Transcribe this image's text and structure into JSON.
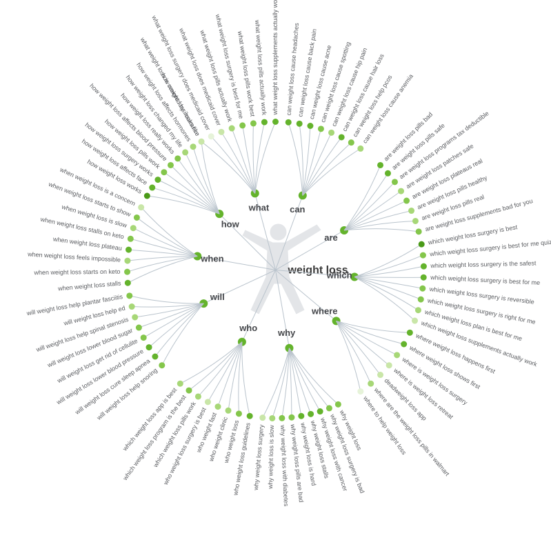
{
  "center": "weight loss",
  "colors": {
    "shade0": "#e6f3d9",
    "shade1": "#c9e6a8",
    "shade2": "#a7d777",
    "shade3": "#84c64b",
    "shade4": "#64b32c",
    "shade5": "#4a9a18"
  },
  "categories": [
    {
      "key": "what",
      "label": "what",
      "angle": -105,
      "leaves": [
        {
          "text": "what weight loss is covered by insurance",
          "shade": 0
        },
        {
          "text": "what weight loss surgery does medicaid cover",
          "shade": 0
        },
        {
          "text": "what weight loss does medicaid cover",
          "shade": 1
        },
        {
          "text": "what weight loss pills actually work",
          "shade": 2
        },
        {
          "text": "what weight loss surgery is best for me",
          "shade": 3
        },
        {
          "text": "what weight loss pills work best",
          "shade": 3
        },
        {
          "text": "what weight loss pills actually work",
          "shade": 4
        },
        {
          "text": "what weight loss supplements actually work",
          "shade": 4
        }
      ]
    },
    {
      "key": "can",
      "label": "can",
      "angle": -70,
      "leaves": [
        {
          "text": "can weight loss cause headaches",
          "shade": 4
        },
        {
          "text": "can weight loss cause back pain",
          "shade": 4
        },
        {
          "text": "can weight loss cause acne",
          "shade": 4
        },
        {
          "text": "can weight loss cause spotting",
          "shade": 3
        },
        {
          "text": "can weight loss cause hip pain",
          "shade": 2
        },
        {
          "text": "can weight loss cause hair loss",
          "shade": 4
        },
        {
          "text": "can weight loss help pcos",
          "shade": 3
        },
        {
          "text": "can weight loss cause anemia",
          "shade": 2
        }
      ]
    },
    {
      "key": "are",
      "label": "are",
      "angle": -30,
      "leaves": [
        {
          "text": "are weight loss pills bad",
          "shade": 4
        },
        {
          "text": "are weight loss pills safe",
          "shade": 4
        },
        {
          "text": "are weight loss programs tax deductible",
          "shade": 3
        },
        {
          "text": "are weight loss patches safe",
          "shade": 2
        },
        {
          "text": "are weight loss plateaus real",
          "shade": 3
        },
        {
          "text": "are weight loss pills healthy",
          "shade": 2
        },
        {
          "text": "are weight loss pills real",
          "shade": 2
        },
        {
          "text": "are weight loss supplements bad for you",
          "shade": 3
        }
      ]
    },
    {
      "key": "which",
      "label": "which",
      "angle": 5,
      "leaves": [
        {
          "text": "which weight loss surgery is best",
          "shade": 5
        },
        {
          "text": "which weight loss surgery is best for me quiz",
          "shade": 3
        },
        {
          "text": "which weight loss surgery is the safest",
          "shade": 4
        },
        {
          "text": "which weight loss surgery is best for me",
          "shade": 4
        },
        {
          "text": "which weight loss surgery is reversible",
          "shade": 3
        },
        {
          "text": "which weight loss surgery is right for me",
          "shade": 3
        },
        {
          "text": "which weight loss plan is best for me",
          "shade": 2
        },
        {
          "text": "which weight loss supplements actually work",
          "shade": 1
        }
      ]
    },
    {
      "key": "where",
      "label": "where",
      "angle": 40,
      "leaves": [
        {
          "text": "where weight loss happens first",
          "shade": 4
        },
        {
          "text": "where weight loss shows first",
          "shade": 4
        },
        {
          "text": "where is weight loss surgery",
          "shade": 2
        },
        {
          "text": "where is weight loss retreat",
          "shade": 1
        },
        {
          "text": "deadweight loss app",
          "shade": 1
        },
        {
          "text": "where are the weight loss pills in walmart",
          "shade": 2
        },
        {
          "text": "where to help weight loss",
          "shade": 0
        }
      ]
    },
    {
      "key": "why",
      "label": "why",
      "angle": 80,
      "leaves": [
        {
          "text": "why weight loss",
          "shade": 3
        },
        {
          "text": "why weight loss surgery is bad",
          "shade": 3
        },
        {
          "text": "why weight loss with cancer",
          "shade": 4
        },
        {
          "text": "why weight loss stalls",
          "shade": 4
        },
        {
          "text": "why weight loss is hard",
          "shade": 4
        },
        {
          "text": "why weight loss pills are bad",
          "shade": 3
        },
        {
          "text": "why weight loss with diabetes",
          "shade": 3
        },
        {
          "text": "why weight loss is slow",
          "shade": 2
        },
        {
          "text": "why weight loss surgery",
          "shade": 1
        }
      ]
    },
    {
      "key": "who",
      "label": "who",
      "angle": 115,
      "leaves": [
        {
          "text": "who weight loss guidelines",
          "shade": 4
        },
        {
          "text": "who weight loss",
          "shade": 3
        },
        {
          "text": "who weight clinic",
          "shade": 2
        },
        {
          "text": "who weight fast",
          "shade": 2
        },
        {
          "text": "who weight loss surgery is best",
          "shade": 1
        },
        {
          "text": "which weight loss pills work",
          "shade": 2
        },
        {
          "text": "which weight loss program is the best",
          "shade": 3
        },
        {
          "text": "which weight loss app is best",
          "shade": 2
        }
      ]
    },
    {
      "key": "will",
      "label": "will",
      "angle": 155,
      "leaves": [
        {
          "text": "will weight loss help snoring",
          "shade": 3
        },
        {
          "text": "will weight loss cure sleep apnea",
          "shade": 4
        },
        {
          "text": "will weight loss lower blood pressure",
          "shade": 4
        },
        {
          "text": "will weight loss get rid of cellulite",
          "shade": 3
        },
        {
          "text": "will weight loss lower blood sugar",
          "shade": 3
        },
        {
          "text": "will weight loss help spinal stenosis",
          "shade": 2
        },
        {
          "text": "will weight loss help ed",
          "shade": 2
        },
        {
          "text": "will weight loss help plantar fasciitis",
          "shade": 3
        }
      ]
    },
    {
      "key": "when",
      "label": "when",
      "angle": 190,
      "leaves": [
        {
          "text": "when weight loss stalls",
          "shade": 4
        },
        {
          "text": "when weight loss starts on keto",
          "shade": 3
        },
        {
          "text": "when weight loss feels impossible",
          "shade": 2
        },
        {
          "text": "when weight loss plateau",
          "shade": 4
        },
        {
          "text": "when weight loss stalls on keto",
          "shade": 3
        },
        {
          "text": "when weight loss is slow",
          "shade": 2
        },
        {
          "text": "when weight loss starts to show",
          "shade": 3
        },
        {
          "text": "when weight loss is a concern",
          "shade": 1
        }
      ]
    },
    {
      "key": "how",
      "label": "how",
      "angle": 225,
      "leaves": [
        {
          "text": "how weight loss works",
          "shade": 5
        },
        {
          "text": "how weight loss affects face",
          "shade": 4
        },
        {
          "text": "how weight loss surgery works",
          "shade": 4
        },
        {
          "text": "how weight loss pills work",
          "shade": 3
        },
        {
          "text": "how weight loss affects blood pressure",
          "shade": 3
        },
        {
          "text": "how weight loss really works",
          "shade": 3
        },
        {
          "text": "how weight loss changed my life",
          "shade": 2
        },
        {
          "text": "how weight loss affects hormones",
          "shade": 2
        },
        {
          "text": "how weight loss looks like",
          "shade": 1
        }
      ]
    }
  ]
}
